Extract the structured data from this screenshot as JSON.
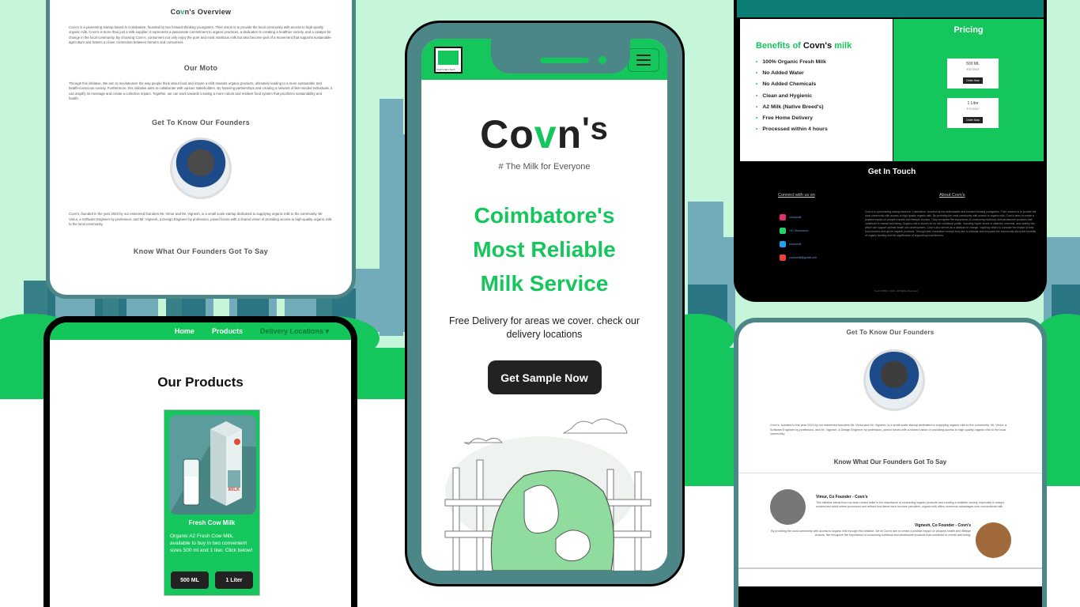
{
  "colors": {
    "accent": "#14c65b",
    "frame": "#4c8686",
    "mint": "#c6f6d9",
    "dark": "#222222"
  },
  "left_top": {
    "overview_title_pre": "Co",
    "overview_title_v": "v",
    "overview_title_post": "n's Overview",
    "overview_text": "Covn's is a pioneering startup based in Coimbatore, founded by two forward-thinking youngsters. Their vision is to provide the local community with access to high-quality organic milk. Covn's is more than just a milk supplier; it represents a passionate commitment to organic practices, a dedication to creating a healthier society, and a catalyst for change in the local community. By choosing Covn's, consumers not only enjoy the pure and most nutritious milk but also become part of a movement that supports sustainable agriculture and fosters a closer connection between farmers and consumers.",
    "moto_title": "Our Moto",
    "moto_text": "Through this initiative, We aim to revolutionize the way people think about food and inspire a shift towards organic products, ultimately leading to a more sustainable and health-conscious society. Furthermore, this initiative aims to collaborate with various stakeholders. By fostering partnerships and creating a network of like-minded individuals, it can amplify its message and create a collective impact. Together, we can work towards creating a more robust and resilient food system that prioritizes sustainability and health.",
    "founders_title": "Get To Know Our Founders",
    "founders_text": "Covn's, founded in the year 2023 by our esteemed founders Mr. Vimur and Mr. Vignesh, is a small scale startup dedicated to supplying organic milk to the community. Mr. Vimur, a Software Engineer by profession, and Mr. Vignesh, a Design Engineer by profession, joined forces with a shared vision of providing access to high-quality organic milk to the local community.",
    "say_title": "Know What Our Founders Got To Say"
  },
  "left_bottom": {
    "nav": [
      "Home",
      "Products",
      "Delivery Locations ▾"
    ],
    "title": "Our Products",
    "card_name": "Fresh Cow Milk",
    "card_desc": "Organic A2 Fresh Cow Milk, available to buy in two convenient sizes 500 ml and 1 liter. Click below!",
    "btn_500": "500 ML",
    "btn_1l": "1 Liter",
    "carton_label": "MILK"
  },
  "center": {
    "logo_text": "Covn's farm fresh",
    "brand_pre": "Co",
    "brand_v": "v",
    "brand_n": "n",
    "brand_s": "'s",
    "tagline": "# The Milk for Everyone",
    "headline": [
      "Coimbatore's",
      "Most Reliable",
      "Milk Service"
    ],
    "sub": "Free Delivery for areas we cover. check our delivery locations",
    "cta": "Get Sample Now"
  },
  "right_top": {
    "benefits_pre": "Benefits of ",
    "benefits_brand": "Covn's",
    "benefits_post": " milk",
    "benefits": [
      "100% Organic Fresh Milk",
      "No Added Water",
      "No Added Chemicals",
      "Clean and Hygienic",
      "A2 Milk (Native Breed's)",
      "Free Home Delivery",
      "Processed within 4 hours"
    ],
    "pricing_title": "Pricing",
    "price1_size": "500 ML",
    "price1_sub": "₹35 ONLY",
    "price2_size": "1 Litre",
    "price2_sub": "₹70 ONLY",
    "order_label": "Order Now",
    "touch_title": "Get In Touch",
    "connect": "Connect with us on",
    "about": "About Covn's",
    "social": [
      "covnsmilk",
      "+91 9xxxxxxxxx",
      "covnsmilk",
      "covnsmilk@gmail.com"
    ],
    "about_text": "Covn's is a pioneering startup based in Coimbatore, founded by two enthusiastic and forward-thinking youngsters. Their mission is to provide the local community with access to high-quality organic milk. By providing the local community with access to organic milk, Covn's aims to create a positive impact on people's health and lifestyle choices. They recognize the importance of consuming nutritious and wholesome products that contribute to overall well-being. Organic milk is known for its rich nutritional profile, including higher levels of vitamins, minerals, and healthy fats which can support optimal health and development. Covn's also serves as a catalyst for change, inspiring others to consider the impact of their food choices and opt for organic products. Through their innovative concept they aim to educate and empower the community about the benefits of organic farming and the significance of supporting local farmers.",
    "footer": "Covn's Milk © 2023 - All Rights Reserved"
  },
  "right_bottom": {
    "founders_title": "Get To Know Our Founders",
    "founders_text": "Covn's, founded in the year 2023 by our esteemed founders Mr. Vimur and Mr. Vignesh, is a small scale startup dedicated to supplying organic milk to the community. Mr. Vimur, a Software Engineer by profession, and Mr. Vignesh, a Design Engineer by profession, joined forces with a shared vision of providing access to high-quality organic milk to the local community.",
    "say_title": "Know What Our Founders Got To Say",
    "f1_name": "Vimur, Co Founder - Covn's",
    "f1_text": "This initiative stems from my deep-rooted belief in the importance of consuming organic products and creating a healthier society, especially in today's modernized world where processed and refined food items have become prevalent, organic milk offers numerous advantages over conventional milk.",
    "f2_name": "Vignesh, Co Founder - Covn's",
    "f2_text": "By providing the local community with access to organic milk through this initiative, We at Covn's aim to create a positive impact on people's health and lifestyle choices. We recognize the importance of consuming nutritious and wholesome products that contribute to overall well-being."
  }
}
